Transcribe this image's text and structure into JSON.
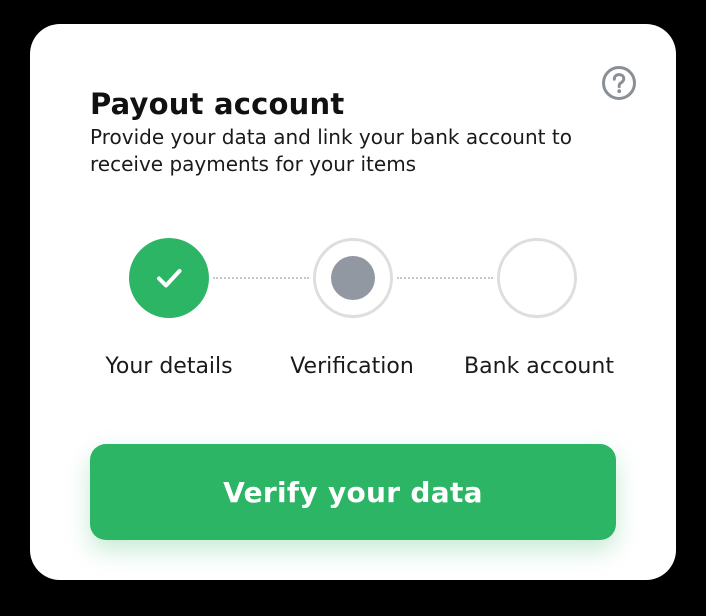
{
  "colors": {
    "accent": "#2db566",
    "step_inactive_border": "#dedede",
    "step_current_dot": "#9298a1",
    "help_icon": "#8a8f96"
  },
  "header": {
    "title": "Payout account",
    "help_icon": "question-circle-icon"
  },
  "description": "Provide your data and link your bank account to receive payments for your items",
  "steps": [
    {
      "label": "Your details",
      "state": "completed",
      "icon": "check-icon"
    },
    {
      "label": "Verification",
      "state": "current"
    },
    {
      "label": "Bank account",
      "state": "pending"
    }
  ],
  "action": {
    "label": "Verify your data"
  }
}
